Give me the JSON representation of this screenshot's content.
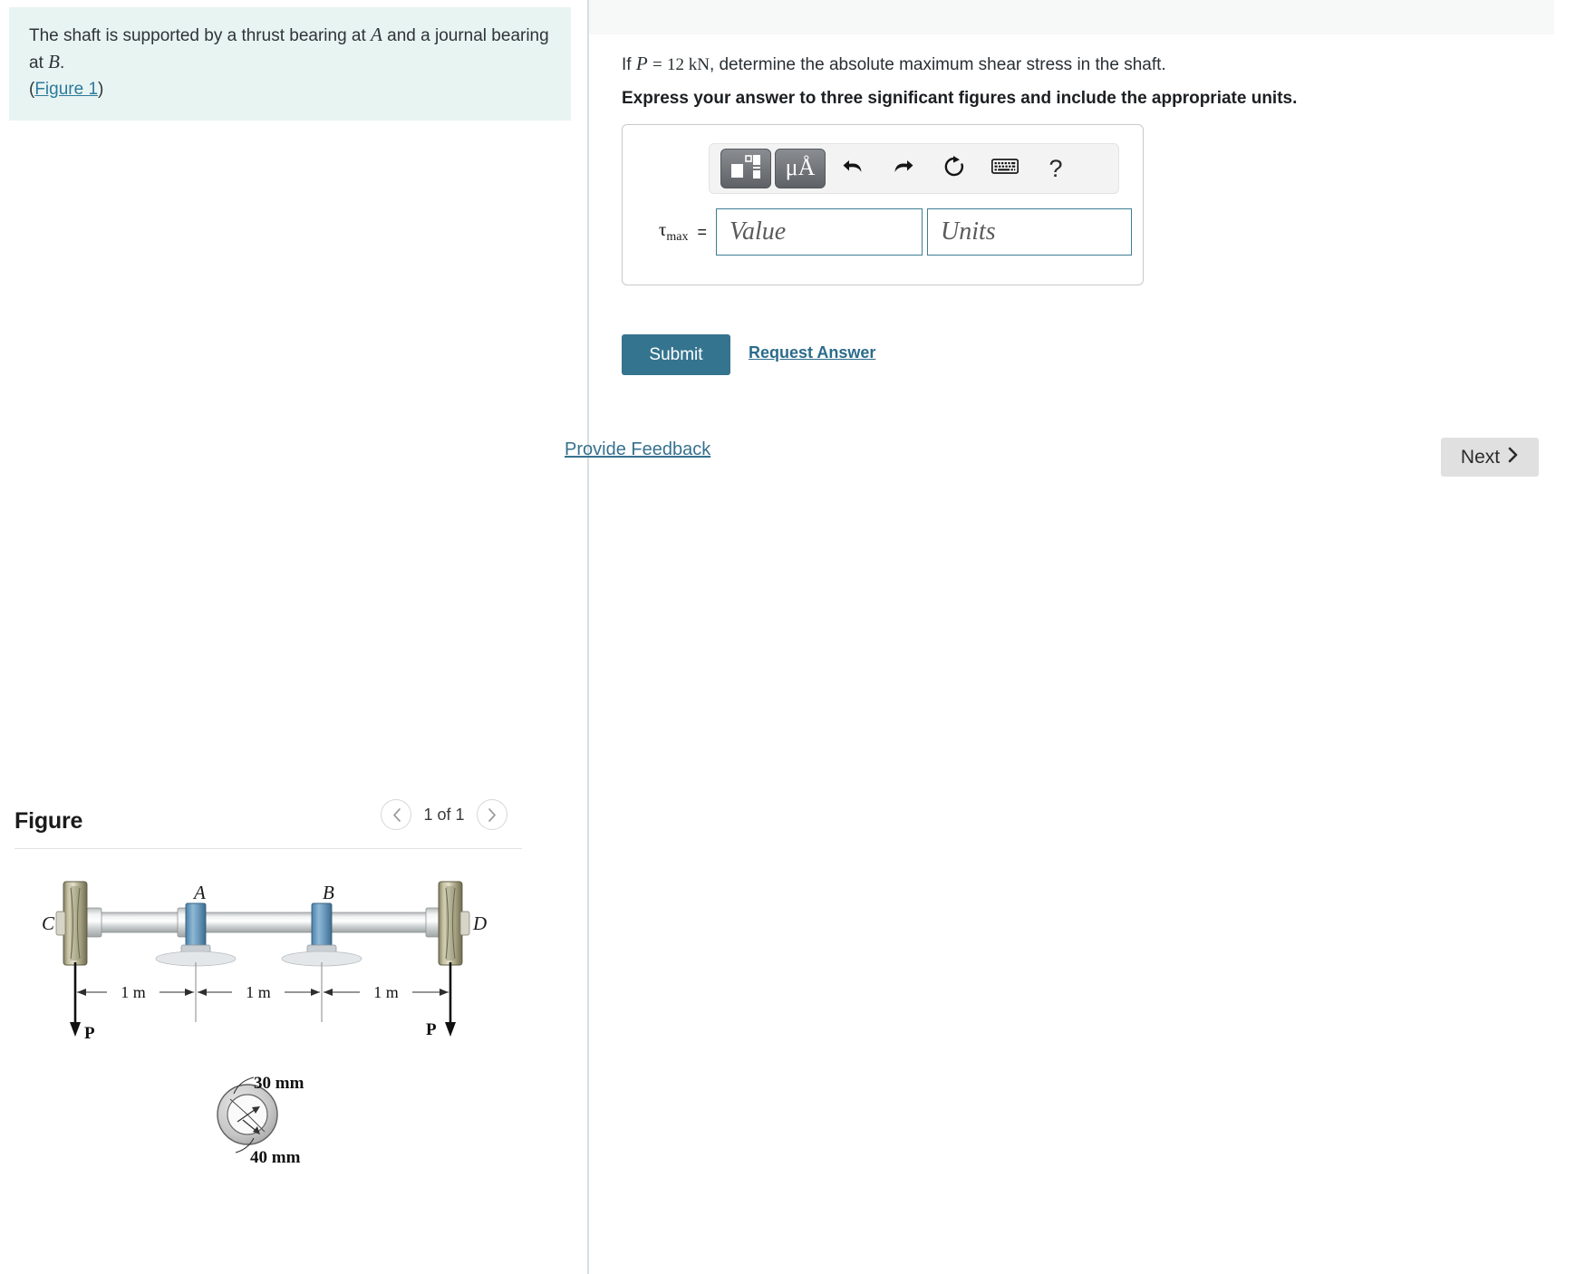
{
  "problem": {
    "text_part1": "The shaft is supported by a thrust bearing at ",
    "var_a": "A",
    "text_part2": " and a journal bearing at ",
    "var_b": "B",
    "period": ".",
    "figure_link": "Figure 1",
    "paren_open": "(",
    "paren_close": ")"
  },
  "question": {
    "if_label": "If",
    "p_symbol": "P",
    "equals": "=",
    "p_value": "12 kN",
    "rest": ", determine the absolute maximum shear stress in the shaft.",
    "instruction": "Express your answer to three significant figures and include the appropriate units."
  },
  "answer": {
    "tau_symbol": "τ",
    "tau_subscript": "max",
    "equals": "=",
    "value_placeholder": "Value",
    "units_placeholder": "Units",
    "value_current": "",
    "units_current": "",
    "toolbar": {
      "template_icon": "math-template-icon",
      "units_icon": "μÅ",
      "undo_icon": "undo-arrow-icon",
      "redo_icon": "redo-arrow-icon",
      "reset_icon": "reset-circular-arrow-icon",
      "keyboard_icon": "keyboard-icon",
      "help_icon": "?"
    }
  },
  "actions": {
    "submit_label": "Submit",
    "request_answer_label": "Request Answer",
    "provide_feedback_label": "Provide Feedback",
    "next_label": "Next",
    "next_chevron": "❯"
  },
  "figure": {
    "title": "Figure",
    "pager_count": "1 of 1",
    "prev_icon": "chevron-left-icon",
    "next_icon": "chevron-right-icon",
    "labels": {
      "c": "C",
      "a": "A",
      "b": "B",
      "d": "D",
      "p_left": "P",
      "p_right": "P",
      "dim1": "1 m",
      "dim2": "1 m",
      "dim3": "1 m",
      "inner_dia": "30 mm",
      "outer_dia": "40 mm"
    }
  },
  "colors": {
    "accent_teal": "#35748f",
    "problem_bg": "#e8f4f2",
    "link": "#2c7a9c",
    "next_bg": "#e0e0e0"
  }
}
